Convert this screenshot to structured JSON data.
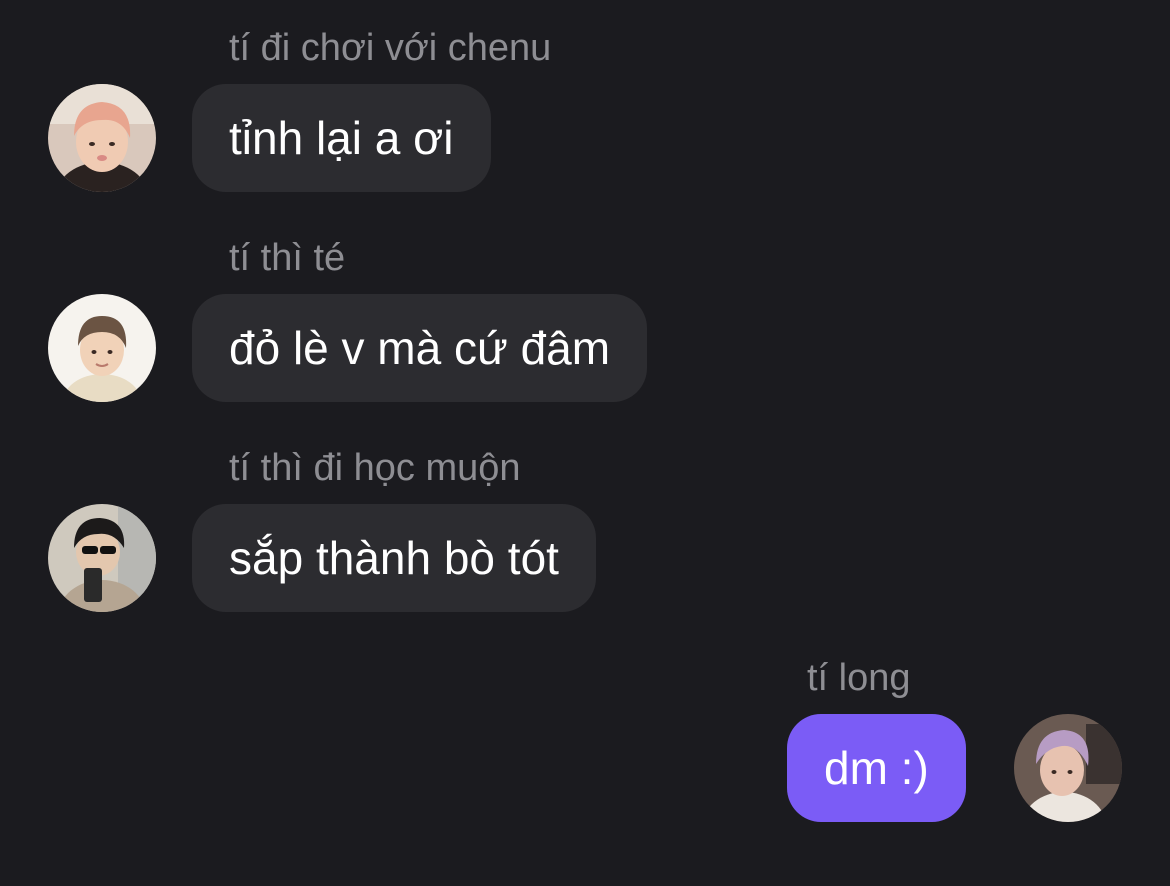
{
  "theme": {
    "background": "#1b1b1f",
    "incoming_bubble": "#2c2c30",
    "outgoing_bubble": "#7b5cf6",
    "sender_text": "#8e8e93",
    "message_text": "#ffffff"
  },
  "messages": [
    {
      "sender": "tí đi chơi với chenu",
      "text": "tỉnh lại a ơi",
      "direction": "incoming",
      "avatar": "pink-hair-user-avatar"
    },
    {
      "sender": "tí thì té",
      "text": "đỏ lè v mà cứ đâm",
      "direction": "incoming",
      "avatar": "light-hair-user-avatar"
    },
    {
      "sender": "tí thì đi học muộn",
      "text": "sắp thành bò tót",
      "direction": "incoming",
      "avatar": "sunglasses-selfie-avatar"
    },
    {
      "sender": "tí long",
      "text": "dm :)",
      "direction": "outgoing",
      "avatar": "purple-hair-user-avatar"
    }
  ]
}
